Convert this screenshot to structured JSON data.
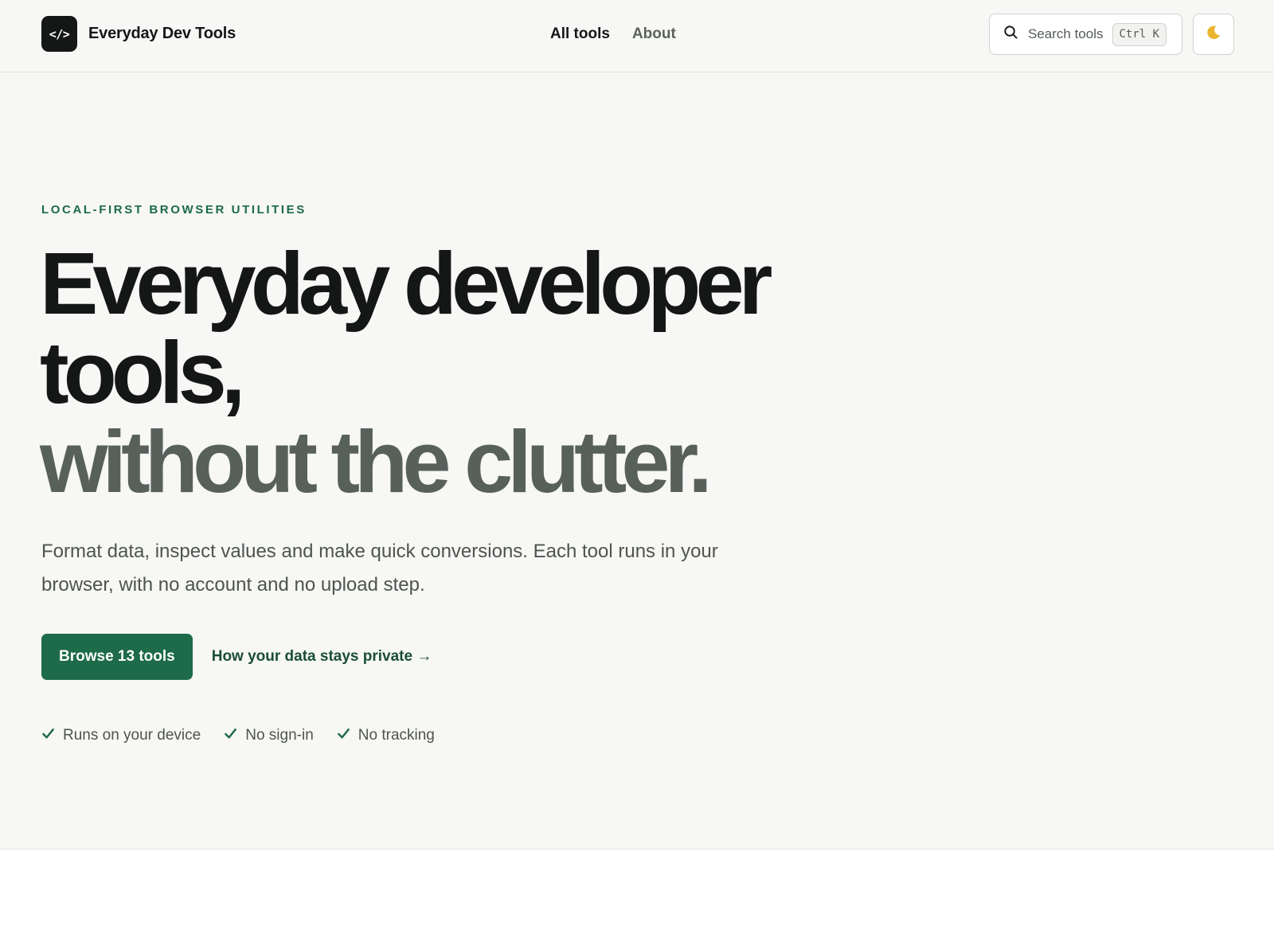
{
  "header": {
    "logo_glyph": "</>",
    "brand_name": "Everyday Dev Tools",
    "nav": [
      {
        "label": "All tools",
        "active": true
      },
      {
        "label": "About",
        "active": false
      }
    ],
    "search": {
      "label": "Search tools",
      "shortcut": "Ctrl K",
      "icon": "search-icon"
    },
    "theme_toggle": {
      "icon": "moon-icon"
    }
  },
  "hero": {
    "eyebrow": "LOCAL-FIRST BROWSER UTILITIES",
    "headline_line1": "Everyday developer",
    "headline_line2": "tools,",
    "headline_line3": "without the clutter.",
    "lede": "Format data, inspect values and make quick conversions. Each tool runs in your browser, with no account and no upload step.",
    "primary_button": "Browse 13 tools",
    "secondary_link": "How your data stays private →",
    "features": [
      {
        "label": "Runs on your device",
        "icon": "check-icon"
      },
      {
        "label": "No sign-in",
        "icon": "check-icon"
      },
      {
        "label": "No tracking",
        "icon": "check-icon"
      }
    ]
  },
  "colors": {
    "accent": "#1d6b48",
    "text": "#141716",
    "muted": "#58605c",
    "background": "#f7f7f5",
    "moon": "#e8b52f"
  }
}
